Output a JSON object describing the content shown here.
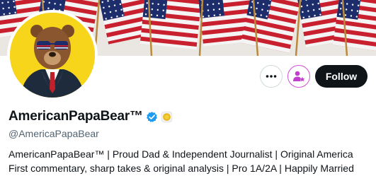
{
  "profile": {
    "display_name": "AmericanPapaBear™",
    "handle": "@AmericaPapaBear",
    "bio": "AmericanPapaBear™ | Proud Dad & Independent Journalist | Original America First commentary, sharp takes & original analysis | Pro 1A/2A | Happily Married",
    "verified_icon": "verified-badge-icon",
    "affiliate_icon": "gold-affiliate-badge-icon"
  },
  "actions": {
    "more_icon": "more-icon",
    "subscribe_icon": "subscribe-icon",
    "follow_label": "Follow"
  },
  "colors": {
    "verified_blue": "#1d9bf0",
    "follow_bg": "#0f1419",
    "subscribe_accent": "#c13fce",
    "avatar_bg": "#f7d51a",
    "handle_gray": "#536471"
  }
}
